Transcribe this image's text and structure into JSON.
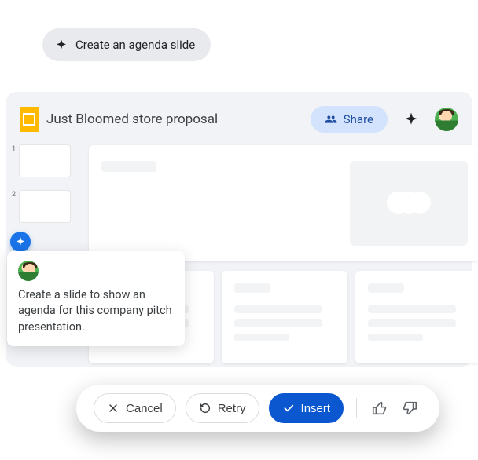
{
  "prompt_chip": {
    "label": "Create an agenda slide"
  },
  "doc": {
    "title": "Just Bloomed store proposal"
  },
  "header": {
    "share_label": "Share"
  },
  "popover": {
    "text": "Create a slide to show an agenda for this company pitch presentation."
  },
  "actions": {
    "cancel": "Cancel",
    "retry": "Retry",
    "insert": "Insert"
  },
  "thumbs": [
    "1",
    "2"
  ]
}
